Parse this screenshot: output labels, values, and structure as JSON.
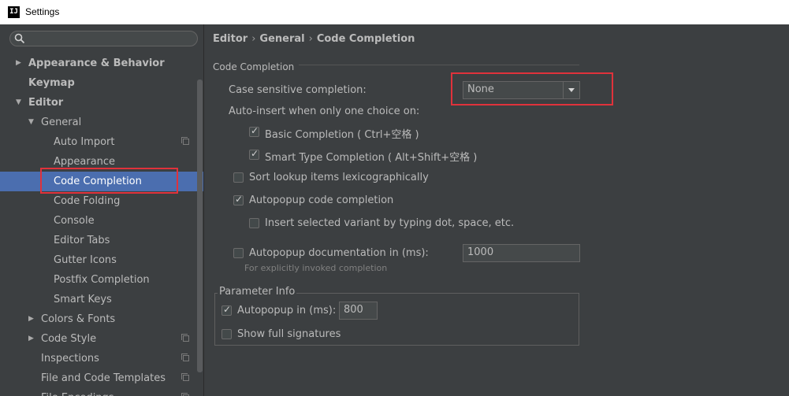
{
  "window": {
    "title": "Settings",
    "icon_text": "IJ"
  },
  "search": {
    "placeholder": ""
  },
  "sidebar": {
    "items": [
      {
        "label": "Appearance & Behavior",
        "bold": true,
        "arrow": "▶",
        "level": 1
      },
      {
        "label": "Keymap",
        "bold": true,
        "arrow": "",
        "level": 1
      },
      {
        "label": "Editor",
        "bold": true,
        "arrow": "▼",
        "level": 1
      },
      {
        "label": "General",
        "arrow": "▼",
        "level": 2
      },
      {
        "label": "Auto Import",
        "level": 3,
        "copy": true
      },
      {
        "label": "Appearance",
        "level": 3
      },
      {
        "label": "Code Completion",
        "level": 3,
        "selected": true
      },
      {
        "label": "Code Folding",
        "level": 3
      },
      {
        "label": "Console",
        "level": 3
      },
      {
        "label": "Editor Tabs",
        "level": 3
      },
      {
        "label": "Gutter Icons",
        "level": 3
      },
      {
        "label": "Postfix Completion",
        "level": 3
      },
      {
        "label": "Smart Keys",
        "level": 3
      },
      {
        "label": "Colors & Fonts",
        "arrow": "▶",
        "level": 2
      },
      {
        "label": "Code Style",
        "arrow": "▶",
        "level": 2,
        "copy": true
      },
      {
        "label": "Inspections",
        "level": 2,
        "copy": true
      },
      {
        "label": "File and Code Templates",
        "level": 2,
        "copy": true
      },
      {
        "label": "File Encodings",
        "level": 2,
        "copy": true
      }
    ]
  },
  "breadcrumb": {
    "part1": "Editor",
    "part2": "General",
    "part3": "Code Completion",
    "sep": "›"
  },
  "code_completion": {
    "section_title": "Code Completion",
    "case_sensitive_label": "Case sensitive completion:",
    "case_sensitive_value": "None",
    "auto_insert_label": "Auto-insert when only one choice on:",
    "basic_completion": {
      "label": "Basic Completion ( Ctrl+空格 )",
      "checked": true
    },
    "smart_type_completion": {
      "label": "Smart Type Completion ( Alt+Shift+空格 )",
      "checked": true
    },
    "sort_lookup": {
      "label": "Sort lookup items lexicographically",
      "checked": false
    },
    "autopopup_code": {
      "label": "Autopopup code completion",
      "checked": true
    },
    "insert_selected_variant": {
      "label": "Insert selected variant by typing dot, space, etc.",
      "checked": false
    },
    "autopopup_doc": {
      "label": "Autopopup documentation in (ms):",
      "checked": false,
      "value": "1000",
      "hint": "For explicitly invoked completion"
    }
  },
  "parameter_info": {
    "title": "Parameter Info",
    "autopopup": {
      "label": "Autopopup in (ms):",
      "checked": true,
      "value": "800"
    },
    "show_full_signatures": {
      "label": "Show full signatures",
      "checked": false
    }
  },
  "colors": {
    "background": "#3c3f41",
    "selection": "#4b6eaf",
    "highlight": "#e0323b",
    "text": "#bbbbbb"
  }
}
